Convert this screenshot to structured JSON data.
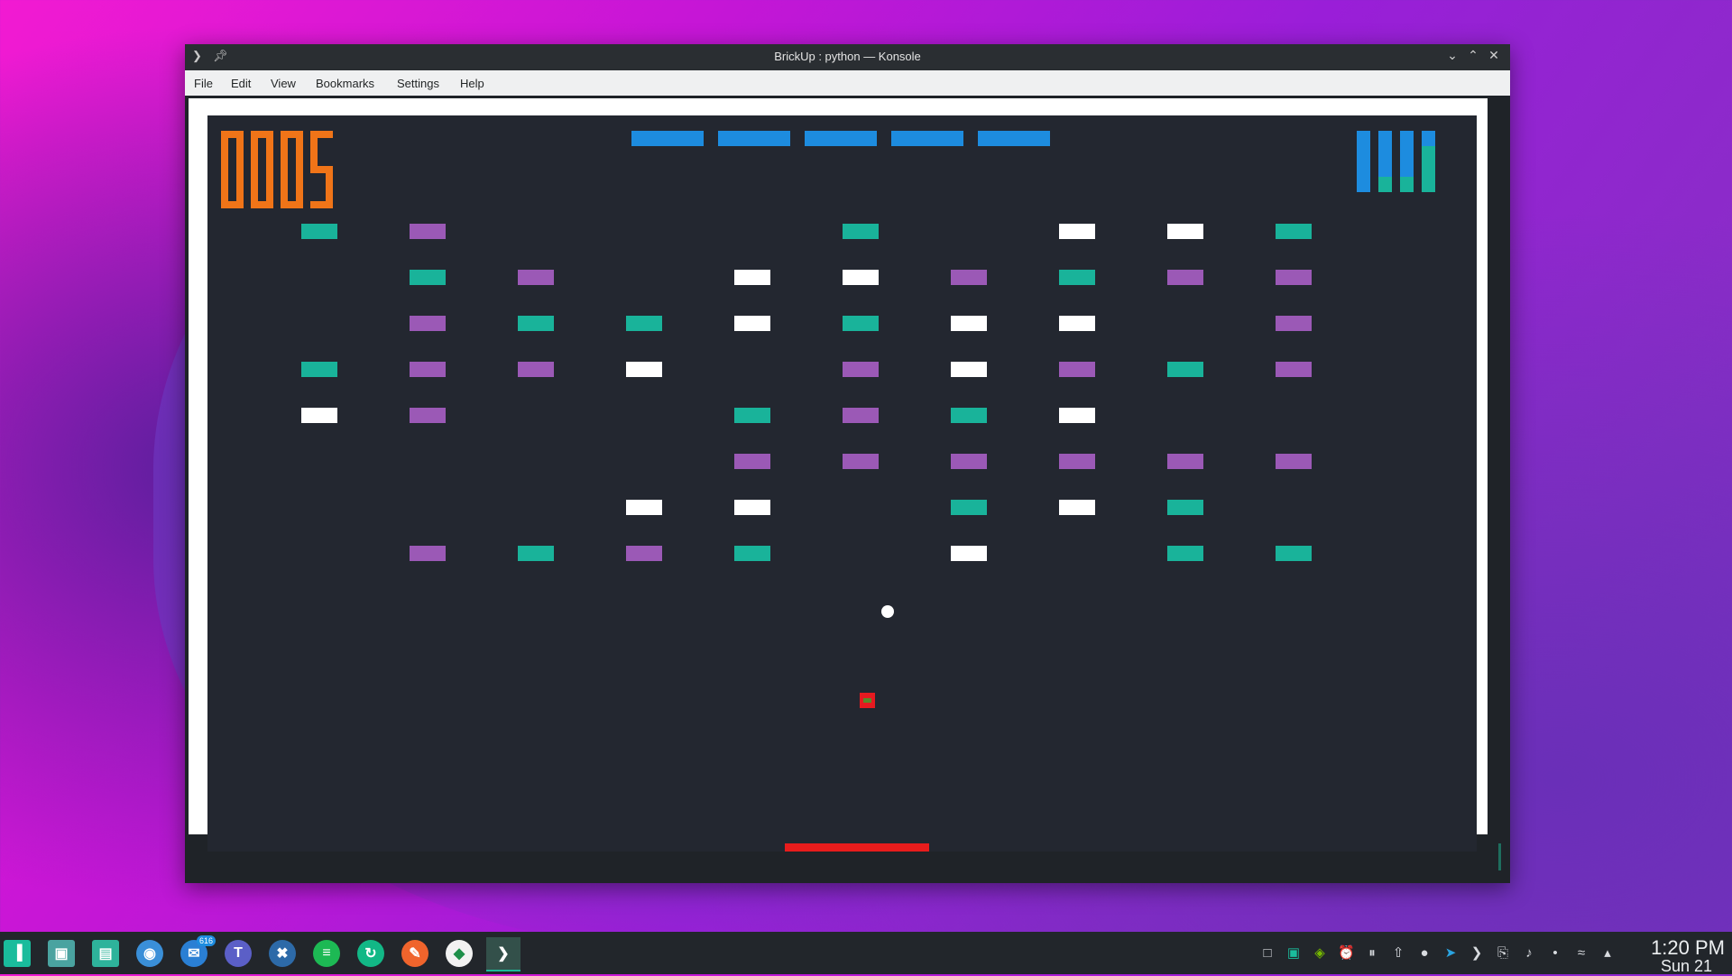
{
  "window": {
    "title": "BrickUp : python — Konsole",
    "icons": {
      "app": "terminal-icon",
      "pin": "pin-icon"
    },
    "controls": [
      "minimize-icon",
      "maximize-icon",
      "close-icon"
    ]
  },
  "menu": [
    "File",
    "Edit",
    "View",
    "Bookmarks",
    "Settings",
    "Help"
  ],
  "game": {
    "score": "0005",
    "colors": {
      "score": "#f07418",
      "bar": "#1d8cdf",
      "teal": "#19b39a",
      "purple": "#9b59b6",
      "white": "#ffffff",
      "paddle": "#e81c1c",
      "background": "#232730"
    },
    "top_bar_segments": 5,
    "lives_total": 4,
    "life_fill_fractions": [
      0,
      0.25,
      0.25,
      0.75
    ],
    "brick_columns": 10,
    "brick_rows": 8,
    "bricks": [
      [
        "teal",
        "purple",
        null,
        null,
        null,
        "teal",
        null,
        "white",
        "white",
        "teal"
      ],
      [
        null,
        "teal",
        "purple",
        null,
        "white",
        "white",
        "purple",
        "teal",
        "purple",
        "purple"
      ],
      [
        null,
        "purple",
        "teal",
        "teal",
        "white",
        "teal",
        "white",
        "white",
        null,
        "purple"
      ],
      [
        "teal",
        "purple",
        "purple",
        "white",
        null,
        "purple",
        "white",
        "purple",
        "teal",
        "purple"
      ],
      [
        "white",
        "purple",
        null,
        null,
        "teal",
        "purple",
        "teal",
        "white",
        null,
        null
      ],
      [
        null,
        null,
        null,
        null,
        "purple",
        "purple",
        "purple",
        "purple",
        "purple",
        "purple"
      ],
      [
        null,
        null,
        null,
        "white",
        "white",
        null,
        "teal",
        "white",
        "teal",
        null
      ],
      [
        null,
        "purple",
        "teal",
        "purple",
        "teal",
        null,
        "white",
        null,
        "teal",
        "teal"
      ]
    ],
    "ball": "ball",
    "powerup": "powerup-capsule",
    "paddle": "paddle"
  },
  "taskbar": {
    "apps": [
      {
        "name": "manjaro-menu-icon",
        "color": "#1abc9c"
      },
      {
        "name": "desktop-pager-icon",
        "color": "#4aa3a0"
      },
      {
        "name": "file-manager-icon",
        "color": "#2eb39b"
      },
      {
        "name": "chromium-icon",
        "color": "#3a8fd8"
      },
      {
        "name": "thunderbird-icon",
        "color": "#2a7fd4",
        "badge": "616"
      },
      {
        "name": "teams-icon",
        "color": "#5b5fc7"
      },
      {
        "name": "vscode-icon",
        "color": "#2d6aa8"
      },
      {
        "name": "spotify-icon",
        "color": "#1db954"
      },
      {
        "name": "sync-icon",
        "color": "#12b886"
      },
      {
        "name": "drawing-icon",
        "color": "#f0642c"
      },
      {
        "name": "mongodb-compass-icon",
        "color": "#f2f2f2"
      },
      {
        "name": "konsole-icon",
        "color": "#33504a",
        "active": true
      }
    ],
    "tray": [
      "show-desktop-icon",
      "folder-icon",
      "nvidia-icon",
      "alarm-icon",
      "pause-icon",
      "update-icon",
      "teams-tray-icon",
      "telegram-icon",
      "terminal-tray-icon",
      "clipboard-icon",
      "volume-icon",
      "microphone-icon",
      "wifi-icon",
      "expand-arrow-icon"
    ],
    "clock": {
      "time": "1:20 PM",
      "date": "Sun 21"
    }
  }
}
